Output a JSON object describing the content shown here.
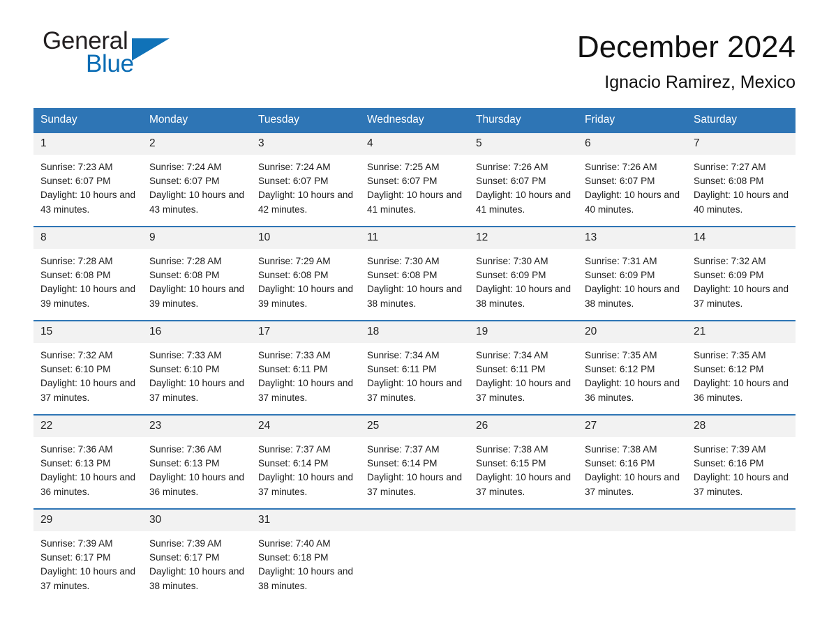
{
  "brand": {
    "name_part1": "General",
    "name_part2": "Blue",
    "accent_color": "#1072b8",
    "triangle_icon": "triangle-right-icon"
  },
  "header": {
    "month_title": "December 2024",
    "location": "Ignacio Ramirez, Mexico"
  },
  "calendar": {
    "weekday_headers": [
      "Sunday",
      "Monday",
      "Tuesday",
      "Wednesday",
      "Thursday",
      "Friday",
      "Saturday"
    ],
    "header_bg": "#2e75b5",
    "daynum_bg": "#f2f2f2",
    "weeks": [
      [
        {
          "day": "1",
          "sunrise": "Sunrise: 7:23 AM",
          "sunset": "Sunset: 6:07 PM",
          "daylight": "Daylight: 10 hours and 43 minutes."
        },
        {
          "day": "2",
          "sunrise": "Sunrise: 7:24 AM",
          "sunset": "Sunset: 6:07 PM",
          "daylight": "Daylight: 10 hours and 43 minutes."
        },
        {
          "day": "3",
          "sunrise": "Sunrise: 7:24 AM",
          "sunset": "Sunset: 6:07 PM",
          "daylight": "Daylight: 10 hours and 42 minutes."
        },
        {
          "day": "4",
          "sunrise": "Sunrise: 7:25 AM",
          "sunset": "Sunset: 6:07 PM",
          "daylight": "Daylight: 10 hours and 41 minutes."
        },
        {
          "day": "5",
          "sunrise": "Sunrise: 7:26 AM",
          "sunset": "Sunset: 6:07 PM",
          "daylight": "Daylight: 10 hours and 41 minutes."
        },
        {
          "day": "6",
          "sunrise": "Sunrise: 7:26 AM",
          "sunset": "Sunset: 6:07 PM",
          "daylight": "Daylight: 10 hours and 40 minutes."
        },
        {
          "day": "7",
          "sunrise": "Sunrise: 7:27 AM",
          "sunset": "Sunset: 6:08 PM",
          "daylight": "Daylight: 10 hours and 40 minutes."
        }
      ],
      [
        {
          "day": "8",
          "sunrise": "Sunrise: 7:28 AM",
          "sunset": "Sunset: 6:08 PM",
          "daylight": "Daylight: 10 hours and 39 minutes."
        },
        {
          "day": "9",
          "sunrise": "Sunrise: 7:28 AM",
          "sunset": "Sunset: 6:08 PM",
          "daylight": "Daylight: 10 hours and 39 minutes."
        },
        {
          "day": "10",
          "sunrise": "Sunrise: 7:29 AM",
          "sunset": "Sunset: 6:08 PM",
          "daylight": "Daylight: 10 hours and 39 minutes."
        },
        {
          "day": "11",
          "sunrise": "Sunrise: 7:30 AM",
          "sunset": "Sunset: 6:08 PM",
          "daylight": "Daylight: 10 hours and 38 minutes."
        },
        {
          "day": "12",
          "sunrise": "Sunrise: 7:30 AM",
          "sunset": "Sunset: 6:09 PM",
          "daylight": "Daylight: 10 hours and 38 minutes."
        },
        {
          "day": "13",
          "sunrise": "Sunrise: 7:31 AM",
          "sunset": "Sunset: 6:09 PM",
          "daylight": "Daylight: 10 hours and 38 minutes."
        },
        {
          "day": "14",
          "sunrise": "Sunrise: 7:32 AM",
          "sunset": "Sunset: 6:09 PM",
          "daylight": "Daylight: 10 hours and 37 minutes."
        }
      ],
      [
        {
          "day": "15",
          "sunrise": "Sunrise: 7:32 AM",
          "sunset": "Sunset: 6:10 PM",
          "daylight": "Daylight: 10 hours and 37 minutes."
        },
        {
          "day": "16",
          "sunrise": "Sunrise: 7:33 AM",
          "sunset": "Sunset: 6:10 PM",
          "daylight": "Daylight: 10 hours and 37 minutes."
        },
        {
          "day": "17",
          "sunrise": "Sunrise: 7:33 AM",
          "sunset": "Sunset: 6:11 PM",
          "daylight": "Daylight: 10 hours and 37 minutes."
        },
        {
          "day": "18",
          "sunrise": "Sunrise: 7:34 AM",
          "sunset": "Sunset: 6:11 PM",
          "daylight": "Daylight: 10 hours and 37 minutes."
        },
        {
          "day": "19",
          "sunrise": "Sunrise: 7:34 AM",
          "sunset": "Sunset: 6:11 PM",
          "daylight": "Daylight: 10 hours and 37 minutes."
        },
        {
          "day": "20",
          "sunrise": "Sunrise: 7:35 AM",
          "sunset": "Sunset: 6:12 PM",
          "daylight": "Daylight: 10 hours and 36 minutes."
        },
        {
          "day": "21",
          "sunrise": "Sunrise: 7:35 AM",
          "sunset": "Sunset: 6:12 PM",
          "daylight": "Daylight: 10 hours and 36 minutes."
        }
      ],
      [
        {
          "day": "22",
          "sunrise": "Sunrise: 7:36 AM",
          "sunset": "Sunset: 6:13 PM",
          "daylight": "Daylight: 10 hours and 36 minutes."
        },
        {
          "day": "23",
          "sunrise": "Sunrise: 7:36 AM",
          "sunset": "Sunset: 6:13 PM",
          "daylight": "Daylight: 10 hours and 36 minutes."
        },
        {
          "day": "24",
          "sunrise": "Sunrise: 7:37 AM",
          "sunset": "Sunset: 6:14 PM",
          "daylight": "Daylight: 10 hours and 37 minutes."
        },
        {
          "day": "25",
          "sunrise": "Sunrise: 7:37 AM",
          "sunset": "Sunset: 6:14 PM",
          "daylight": "Daylight: 10 hours and 37 minutes."
        },
        {
          "day": "26",
          "sunrise": "Sunrise: 7:38 AM",
          "sunset": "Sunset: 6:15 PM",
          "daylight": "Daylight: 10 hours and 37 minutes."
        },
        {
          "day": "27",
          "sunrise": "Sunrise: 7:38 AM",
          "sunset": "Sunset: 6:16 PM",
          "daylight": "Daylight: 10 hours and 37 minutes."
        },
        {
          "day": "28",
          "sunrise": "Sunrise: 7:39 AM",
          "sunset": "Sunset: 6:16 PM",
          "daylight": "Daylight: 10 hours and 37 minutes."
        }
      ],
      [
        {
          "day": "29",
          "sunrise": "Sunrise: 7:39 AM",
          "sunset": "Sunset: 6:17 PM",
          "daylight": "Daylight: 10 hours and 37 minutes."
        },
        {
          "day": "30",
          "sunrise": "Sunrise: 7:39 AM",
          "sunset": "Sunset: 6:17 PM",
          "daylight": "Daylight: 10 hours and 38 minutes."
        },
        {
          "day": "31",
          "sunrise": "Sunrise: 7:40 AM",
          "sunset": "Sunset: 6:18 PM",
          "daylight": "Daylight: 10 hours and 38 minutes."
        },
        null,
        null,
        null,
        null
      ]
    ]
  }
}
